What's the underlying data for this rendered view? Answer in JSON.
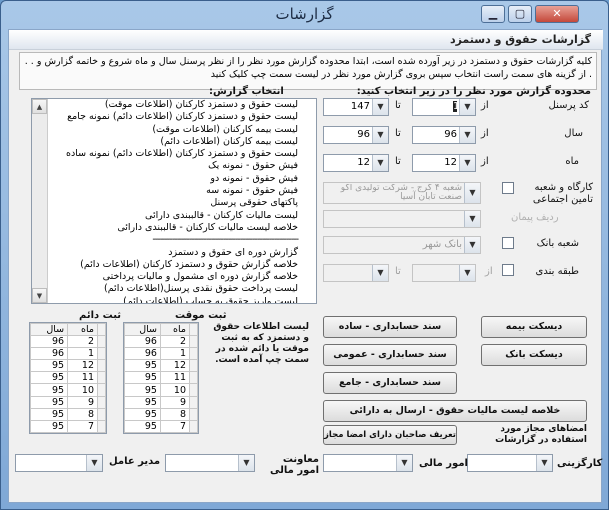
{
  "window": {
    "title": "گزارشات"
  },
  "header": {
    "title": "گزارشات حقوق و دستمزد"
  },
  "description": "کلیه گزارشات حقوق و دستمزد در زیر آورده شده است، ابتدا محدوده گزارش مورد نظر را از نظر پرسنل سال و ماه شروع و خاتمه گزارش و . . . از گزینه های سمت راست انتخاب سپس بروی گزارش مورد نظر در لیست سمت چپ کلیک کنید",
  "range": {
    "title": "محدوده گزارش مورد نظر را در زیر انتخاب کنید:",
    "from_label": "از",
    "to_label": "تا",
    "personnel": {
      "label": "کد پرسنل",
      "from": "1",
      "to": "147"
    },
    "year": {
      "label": "سال",
      "from": "96",
      "to": "96"
    },
    "month": {
      "label": "ماه",
      "from": "12",
      "to": "12"
    },
    "workshop": {
      "label": "کارگاه و شعبه تامین اجتماعی",
      "value": "شعبه ۴ کرج - شرکت تولیدی آکو صنعت تابان آسیا"
    },
    "row_disabled": {
      "label": "ردیف پیمان"
    },
    "bank_branch": {
      "label": "شعبه بانک",
      "value": "بانک شهر"
    },
    "category": {
      "label": "طبقه بندی"
    }
  },
  "reports": {
    "title": "انتخاب گزارش:",
    "items": [
      "لیست حقوق و دستمزد کارکنان (اطلاعات موقت)",
      "لیست حقوق و دستمزد کارکنان (اطلاعات دائم) نمونه جامع",
      "لیست بیمه کارکنان (اطلاعات موقت)",
      "لیست بیمه کارکنان (اطلاعات دائم)",
      "لیست حقوق و دستمزد کارکنان (اطلاعات دائم) نمونه ساده",
      "فیش حقوق - نمونه یک",
      "فیش حقوق - نمونه دو",
      "فیش حقوق - نمونه سه",
      "پاکتهای حقوقی پرسنل",
      "لیست مالیات کارکنان - قالببندی دارائی",
      "خلاصه لیست مالیات کارکنان - قالببندی دارائی",
      "------------------------------------------------------------",
      "گزارش دوره ای حقوق و دستمزد",
      "خلاصه گزارش حقوق و دستمزد کارکنان (اطلاعات دائم)",
      "خلاصه گزارش دوره ای مشمول و مالیات پرداختی",
      "لیست پرداخت حقوق نقدی پرسنل(اطلاعات دائم)",
      "لیست واریز حقوق به حساب (اطلاعات دائم)"
    ]
  },
  "temp_grid": {
    "title": "ثبت موقت",
    "headers": {
      "year": "سال",
      "month": "ماه"
    },
    "rows": [
      [
        "96",
        "2"
      ],
      [
        "96",
        "1"
      ],
      [
        "95",
        "12"
      ],
      [
        "95",
        "11"
      ],
      [
        "95",
        "10"
      ],
      [
        "95",
        "9"
      ],
      [
        "95",
        "8"
      ],
      [
        "95",
        "7"
      ]
    ]
  },
  "perm_grid": {
    "title": "ثبت دائم",
    "headers": {
      "year": "سال",
      "month": "ماه"
    },
    "rows": [
      [
        "96",
        "2"
      ],
      [
        "96",
        "1"
      ],
      [
        "95",
        "12"
      ],
      [
        "95",
        "11"
      ],
      [
        "95",
        "10"
      ],
      [
        "95",
        "9"
      ],
      [
        "95",
        "8"
      ],
      [
        "95",
        "7"
      ]
    ]
  },
  "grid_note": "لیست اطلاعات حقوق و دستمزد که به ثبت موقت یا دائم شده در سمت چپ آمده است.",
  "buttons": {
    "disk_insurance": "دیسکت بیمه",
    "disk_bank": "دیسکت بانک",
    "acc_doc_simple": "سند حسابداری - ساده",
    "acc_doc_general": "سند حسابداری - عمومی",
    "acc_doc_full": "سند حسابداری - جامع",
    "tax_summary": "خلاصه لیست مالیات حقوق - ارسال به دارائی",
    "define_signers": "تعریف صاحبان دارای امضا مجاز"
  },
  "signatures": {
    "title": "امضاهای مجاز مورد استفاده در گزارشات",
    "hr_label": "کارگزینی",
    "finance_label": "امور مالی",
    "deputy_label": "معاونت امور مالی",
    "ceo_label": "مدیر عامل"
  }
}
